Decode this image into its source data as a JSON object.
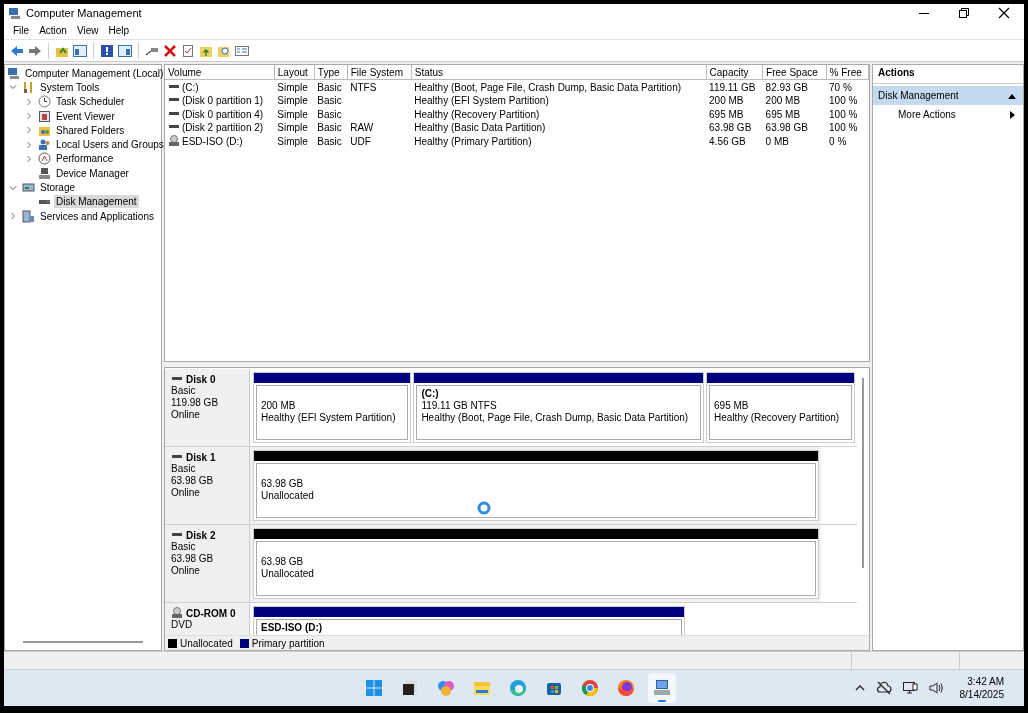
{
  "window": {
    "title": "Computer Management"
  },
  "menu": [
    "File",
    "Action",
    "View",
    "Help"
  ],
  "tree": [
    {
      "label": "Computer Management (Local)",
      "selected": false,
      "children": [
        {
          "label": "System Tools",
          "expandable": true,
          "expanded": true,
          "selected": false,
          "children": [
            {
              "label": "Task Scheduler",
              "expandable": true,
              "expanded": false,
              "selected": false
            },
            {
              "label": "Event Viewer",
              "expandable": true,
              "expanded": false,
              "selected": false
            },
            {
              "label": "Shared Folders",
              "expandable": true,
              "expanded": false,
              "selected": false
            },
            {
              "label": "Local Users and Groups",
              "expandable": true,
              "expanded": false,
              "selected": false
            },
            {
              "label": "Performance",
              "expandable": true,
              "expanded": false,
              "selected": false
            },
            {
              "label": "Device Manager",
              "selected": false
            }
          ]
        },
        {
          "label": "Storage",
          "expandable": true,
          "expanded": true,
          "selected": false,
          "children": [
            {
              "label": "Disk Management",
              "selected": true
            }
          ]
        },
        {
          "label": "Services and Applications",
          "expandable": true,
          "expanded": false,
          "selected": false
        }
      ]
    }
  ],
  "volumes": {
    "columns": [
      "Volume",
      "Layout",
      "Type",
      "File System",
      "Status",
      "Capacity",
      "Free Space",
      "% Free"
    ],
    "rows": [
      {
        "kind": "disk",
        "cells": [
          "(C:)",
          "Simple",
          "Basic",
          "NTFS",
          "Healthy (Boot, Page File, Crash Dump, Basic Data Partition)",
          "119.11 GB",
          "82.93 GB",
          "70 %"
        ]
      },
      {
        "kind": "disk",
        "cells": [
          "(Disk 0 partition 1)",
          "Simple",
          "Basic",
          "",
          "Healthy (EFI System Partition)",
          "200 MB",
          "200 MB",
          "100 %"
        ]
      },
      {
        "kind": "disk",
        "cells": [
          "(Disk 0 partition 4)",
          "Simple",
          "Basic",
          "",
          "Healthy (Recovery Partition)",
          "695 MB",
          "695 MB",
          "100 %"
        ]
      },
      {
        "kind": "disk",
        "cells": [
          "(Disk 2 partition 2)",
          "Simple",
          "Basic",
          "RAW",
          "Healthy (Basic Data Partition)",
          "63.98 GB",
          "63.98 GB",
          "100 %"
        ]
      },
      {
        "kind": "cdrom",
        "cells": [
          "ESD-ISO (D:)",
          "Simple",
          "Basic",
          "UDF",
          "Healthy (Primary Partition)",
          "4.56 GB",
          "0 MB",
          "0 %"
        ]
      }
    ]
  },
  "disks": [
    {
      "kind": "disk",
      "name": "Disk 0",
      "type": "Basic",
      "size": "119.98 GB",
      "status": "Online",
      "partitions": [
        {
          "kind": "primary",
          "size": "200 MB",
          "status": "Healthy (EFI System Partition)"
        },
        {
          "kind": "primary",
          "label": "(C:)",
          "size": "119.11 GB NTFS",
          "status": "Healthy (Boot, Page File, Crash Dump, Basic Data Partition)"
        },
        {
          "kind": "primary",
          "size": "695 MB",
          "status": "Healthy (Recovery Partition)"
        }
      ]
    },
    {
      "kind": "disk",
      "name": "Disk 1",
      "type": "Basic",
      "size": "63.98 GB",
      "status": "Online",
      "partitions": [
        {
          "kind": "unallocated",
          "size": "63.98 GB",
          "status": "Unallocated"
        }
      ]
    },
    {
      "kind": "disk",
      "name": "Disk 2",
      "type": "Basic",
      "size": "63.98 GB",
      "status": "Online",
      "partitions": [
        {
          "kind": "unallocated",
          "size": "63.98 GB",
          "status": "Unallocated"
        }
      ]
    },
    {
      "kind": "cdrom",
      "name": "CD-ROM 0",
      "type": "DVD",
      "partitions": [
        {
          "kind": "primary",
          "label": "ESD-ISO  (D:)"
        }
      ]
    }
  ],
  "legend": [
    {
      "kind": "unallocated",
      "label": "Unallocated",
      "color": "#000000"
    },
    {
      "kind": "primary",
      "label": "Primary partition",
      "color": "#00007f"
    }
  ],
  "actions": {
    "title": "Actions",
    "sections": [
      {
        "title": "Disk Management",
        "expanded": true,
        "items": [
          "More Actions"
        ]
      }
    ]
  },
  "taskbar": {
    "apps": [
      {
        "selected": false
      },
      {
        "selected": false
      },
      {
        "selected": false
      },
      {
        "selected": false
      },
      {
        "selected": false
      },
      {
        "selected": false
      },
      {
        "selected": false
      },
      {
        "selected": false
      },
      {
        "selected": true
      }
    ],
    "clock": {
      "time": "3:42 AM",
      "date": "8/14/2025"
    }
  }
}
